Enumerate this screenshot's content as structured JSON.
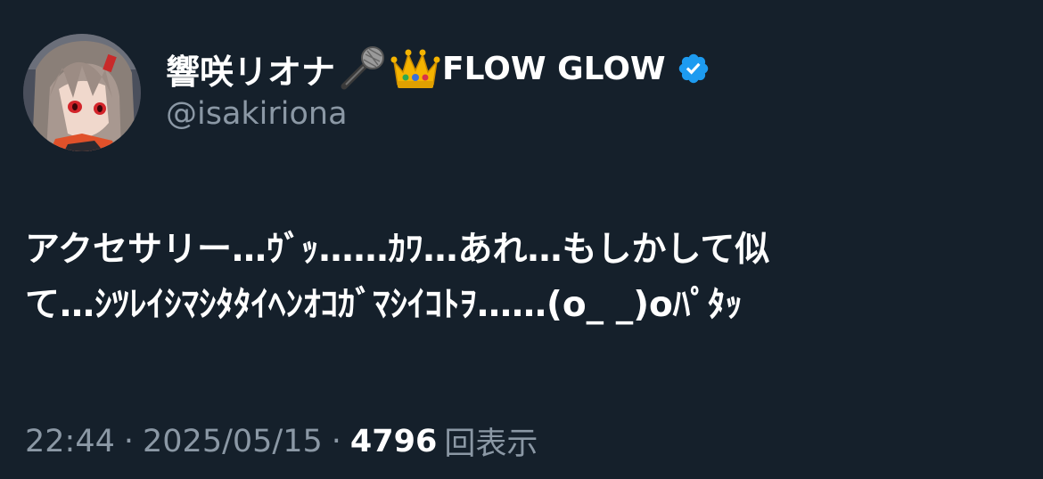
{
  "author": {
    "display_name": "響咲リオナ",
    "name_suffix": "FLOW GLOW",
    "handle": "@isakiriona",
    "verified": true,
    "name_emojis": [
      "microphone-icon",
      "crown-icon"
    ]
  },
  "tweet": {
    "lines": [
      "アクセサリー…ｳﾞｯ……ｶﾜ…あれ…もしかして似",
      "て…ｼﾂﾚｲｼﾏｼﾀﾀｲﾍﾝｵｺｶﾞﾏｼｲｺﾄｦ……(o_ _)oﾊﾟﾀｯ"
    ]
  },
  "meta": {
    "time": "22:44",
    "separator": "·",
    "date": "2025/05/15",
    "views_count": "4796",
    "views_label": "回表示"
  },
  "colors": {
    "background": "#15202b",
    "primary_text": "#ffffff",
    "secondary_text": "#8b98a5",
    "verified_badge": "#1d9bf0"
  }
}
